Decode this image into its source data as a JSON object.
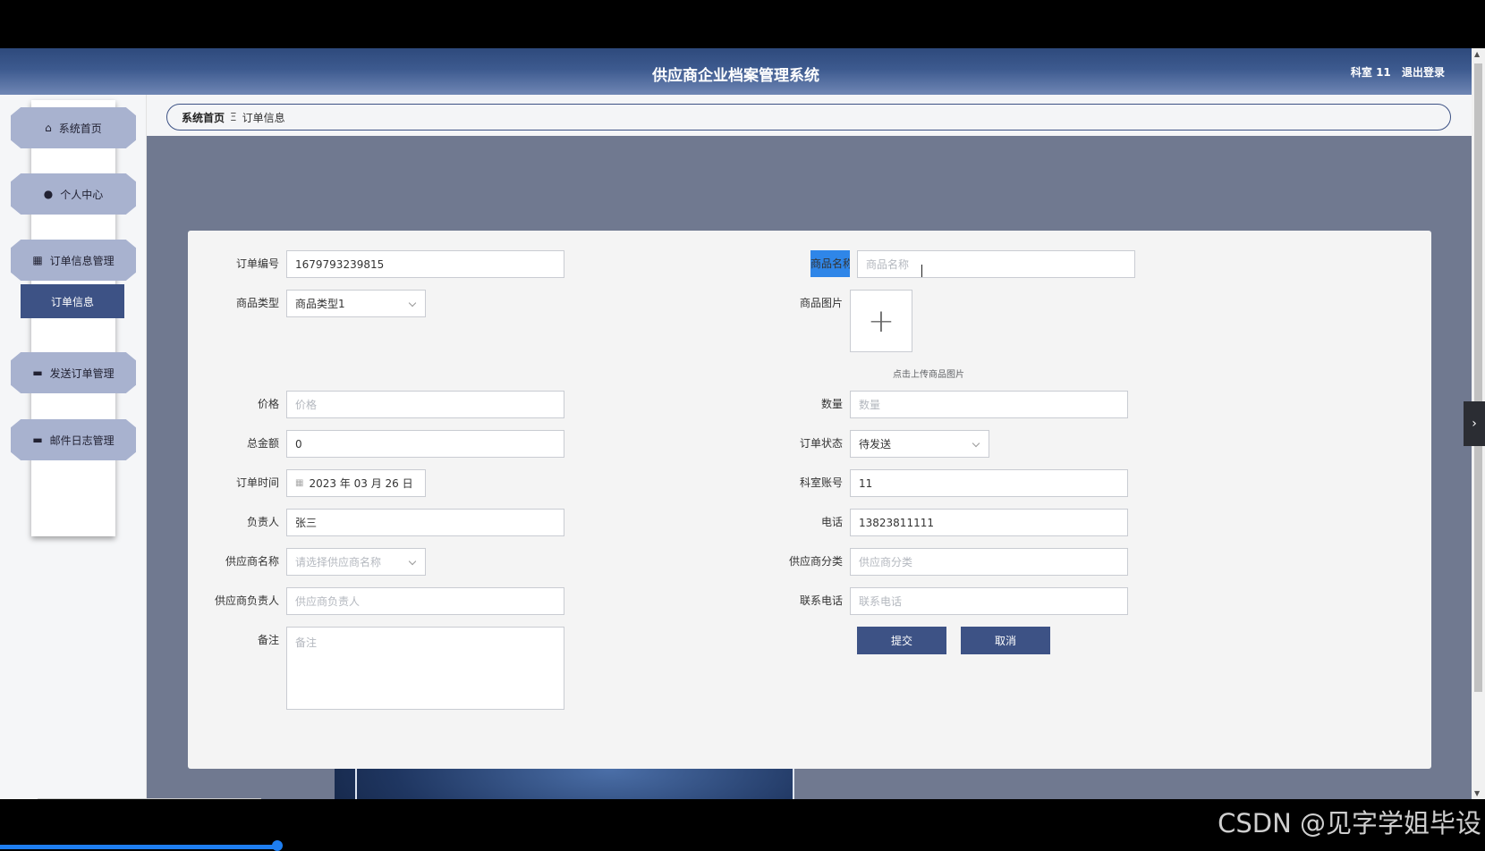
{
  "header": {
    "title": "供应商企业档案管理系统",
    "user_label": "科室 11",
    "logout_label": "退出登录"
  },
  "sidebar": {
    "items": [
      {
        "label": "系统首页",
        "icon": "home-icon"
      },
      {
        "label": "个人中心",
        "icon": "user-icon"
      },
      {
        "label": "订单信息管理",
        "icon": "grid-icon"
      },
      {
        "label": "发送订单管理",
        "icon": "monitor-icon"
      },
      {
        "label": "邮件日志管理",
        "icon": "monitor-icon"
      }
    ],
    "submenu": {
      "label": "订单信息"
    }
  },
  "breadcrumb": {
    "home": "系统首页",
    "separator": "Ξ",
    "current": "订单信息"
  },
  "form": {
    "order_no": {
      "label": "订单编号",
      "value": "1679793239815"
    },
    "product_type": {
      "label": "商品类型",
      "value": "商品类型1"
    },
    "price": {
      "label": "价格",
      "placeholder": "价格"
    },
    "total": {
      "label": "总金额",
      "value": "0"
    },
    "order_time": {
      "label": "订单时间",
      "value": "2023 年 03 月 26 日"
    },
    "manager": {
      "label": "负责人",
      "value": "张三"
    },
    "supplier_name": {
      "label": "供应商名称",
      "placeholder": "请选择供应商名称"
    },
    "supplier_manager": {
      "label": "供应商负责人",
      "placeholder": "供应商负责人"
    },
    "remark": {
      "label": "备注",
      "placeholder": "备注"
    },
    "product_name": {
      "label": "商品名称",
      "placeholder": "商品名称"
    },
    "product_image": {
      "label": "商品图片",
      "hint": "点击上传商品图片"
    },
    "quantity": {
      "label": "数量",
      "placeholder": "数量"
    },
    "order_status": {
      "label": "订单状态",
      "value": "待发送"
    },
    "dept_account": {
      "label": "科室账号",
      "value": "11"
    },
    "phone": {
      "label": "电话",
      "value": "13823811111"
    },
    "supplier_category": {
      "label": "供应商分类",
      "placeholder": "供应商分类"
    },
    "contact_phone": {
      "label": "联系电话",
      "placeholder": "联系电话"
    },
    "submit_label": "提交",
    "cancel_label": "取消"
  },
  "overlay": {
    "watermark": "CSDN @见字学姐毕设"
  },
  "colors": {
    "header": "#3d5a8f",
    "accent": "#3d5285",
    "highlight": "#2f86e8",
    "main_bg": "#707990"
  }
}
